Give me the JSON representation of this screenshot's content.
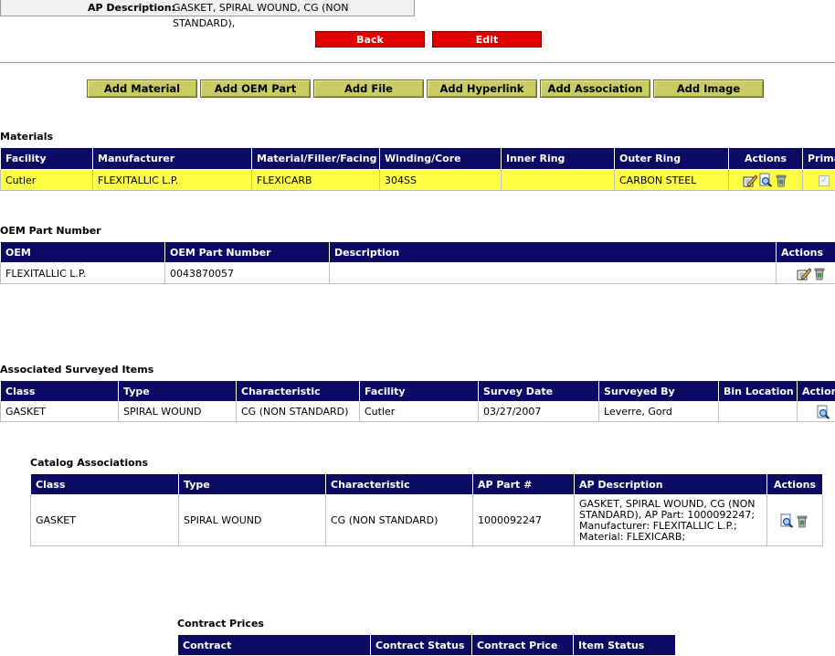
{
  "ap_description": {
    "label": "AP Description:",
    "value": "GASKET, SPIRAL WOUND, CG (NON STANDARD),"
  },
  "nav_buttons": {
    "back": "Back",
    "edit": "Edit"
  },
  "add_buttons": [
    "Add Material",
    "Add OEM Part",
    "Add File",
    "Add Hyperlink",
    "Add Association",
    "Add Image"
  ],
  "materials": {
    "title": "Materials",
    "headers": [
      "Facility",
      "Manufacturer",
      "Material/Filler/Facing",
      "Winding/Core",
      "Inner Ring",
      "Outer Ring",
      "Actions",
      "Prima"
    ],
    "rows": [
      {
        "facility": "Cutler",
        "manufacturer": "FLEXITALLIC L.P.",
        "material": "FLEXICARB",
        "winding": "304SS",
        "inner_ring": "",
        "outer_ring": "CARBON STEEL",
        "primary_checked": true
      }
    ]
  },
  "oem": {
    "title": "OEM Part Number",
    "headers": [
      "OEM",
      "OEM Part Number",
      "Description",
      "Actions"
    ],
    "rows": [
      {
        "oem": "FLEXITALLIC L.P.",
        "part_number": "0043870057",
        "description": ""
      }
    ]
  },
  "surveyed": {
    "title": "Associated Surveyed Items",
    "headers": [
      "Class",
      "Type",
      "Characteristic",
      "Facility",
      "Survey Date",
      "Surveyed By",
      "Bin Location",
      "Action"
    ],
    "rows": [
      {
        "class": "GASKET",
        "type": "SPIRAL WOUND",
        "characteristic": "CG (NON STANDARD)",
        "facility": "Cutler",
        "survey_date": "03/27/2007",
        "surveyed_by": "Leverre, Gord",
        "bin_location": ""
      }
    ]
  },
  "catalog": {
    "title": "Catalog Associations",
    "headers": [
      "Class",
      "Type",
      "Characteristic",
      "AP Part #",
      "AP Description",
      "Actions"
    ],
    "rows": [
      {
        "class": "GASKET",
        "type": "SPIRAL WOUND",
        "characteristic": "CG (NON STANDARD)",
        "ap_part": "1000092247",
        "ap_description": "GASKET, SPIRAL WOUND, CG (NON STANDARD), AP Part: 1000092247; Manufacturer: FLEXITALLIC L.P.; Material: FLEXICARB;"
      }
    ]
  },
  "contract": {
    "title": "Contract Prices",
    "headers": [
      "Contract",
      "Contract Status",
      "Contract Price",
      "Item Status"
    ]
  },
  "colors": {
    "header_bg": "#0b0b63",
    "highlight_row": "#ffff44",
    "red_button": "#e00000",
    "green_button": "#cccc66"
  },
  "icons": {
    "edit": "edit-pencil-icon",
    "view": "magnifier-icon",
    "delete": "trash-bin-icon"
  }
}
